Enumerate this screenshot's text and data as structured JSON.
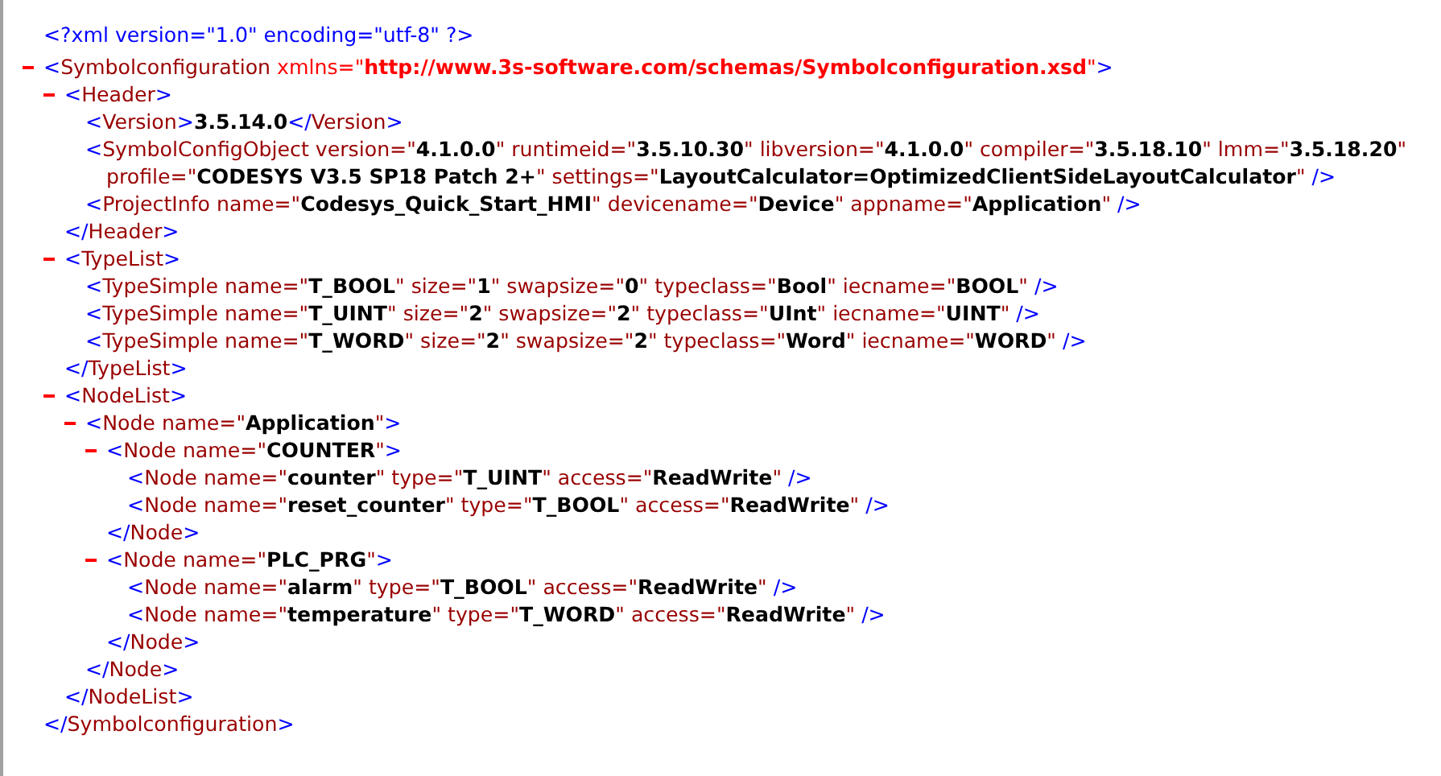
{
  "declaration": "<?xml version=\"1.0\" encoding=\"utf-8\" ?>",
  "root": {
    "open": "<Symbolconfiguration xmlns=\"http://www.3s-software.com/schemas/Symbolconfiguration.xsd\">",
    "namespace_attribute": true,
    "close": "</Symbolconfiguration>",
    "expanded": true,
    "children": [
      {
        "open": "<Header>",
        "close": "</Header>",
        "expanded": true,
        "children": [
          {
            "open": "<Version>3.5.14.0</Version>"
          },
          {
            "open": "<SymbolConfigObject version=\"4.1.0.0\" runtimeid=\"3.5.10.30\" libversion=\"4.1.0.0\" compiler=\"3.5.18.10\" lmm=\"3.5.18.20\" profile=\"CODESYS V3.5 SP18 Patch 2+\" settings=\"LayoutCalculator=OptimizedClientSideLayoutCalculator\" />"
          },
          {
            "open": "<ProjectInfo name=\"Codesys_Quick_Start_HMI\" devicename=\"Device\" appname=\"Application\" />"
          }
        ]
      },
      {
        "open": "<TypeList>",
        "close": "</TypeList>",
        "expanded": true,
        "children": [
          {
            "open": "<TypeSimple name=\"T_BOOL\" size=\"1\" swapsize=\"0\" typeclass=\"Bool\" iecname=\"BOOL\" />"
          },
          {
            "open": "<TypeSimple name=\"T_UINT\" size=\"2\" swapsize=\"2\" typeclass=\"UInt\" iecname=\"UINT\" />"
          },
          {
            "open": "<TypeSimple name=\"T_WORD\" size=\"2\" swapsize=\"2\" typeclass=\"Word\" iecname=\"WORD\" />"
          }
        ]
      },
      {
        "open": "<NodeList>",
        "close": "</NodeList>",
        "expanded": true,
        "children": [
          {
            "open": "<Node name=\"Application\">",
            "close": "</Node>",
            "expanded": true,
            "children": [
              {
                "open": "<Node name=\"COUNTER\">",
                "close": "</Node>",
                "expanded": true,
                "children": [
                  {
                    "open": "<Node name=\"counter\" type=\"T_UINT\" access=\"ReadWrite\" />"
                  },
                  {
                    "open": "<Node name=\"reset_counter\" type=\"T_BOOL\" access=\"ReadWrite\" />"
                  }
                ]
              },
              {
                "open": "<Node name=\"PLC_PRG\">",
                "close": "</Node>",
                "expanded": true,
                "children": [
                  {
                    "open": "<Node name=\"alarm\" type=\"T_BOOL\" access=\"ReadWrite\" />"
                  },
                  {
                    "open": "<Node name=\"temperature\" type=\"T_WORD\" access=\"ReadWrite\" />"
                  }
                ]
              }
            ]
          }
        ]
      }
    ]
  }
}
